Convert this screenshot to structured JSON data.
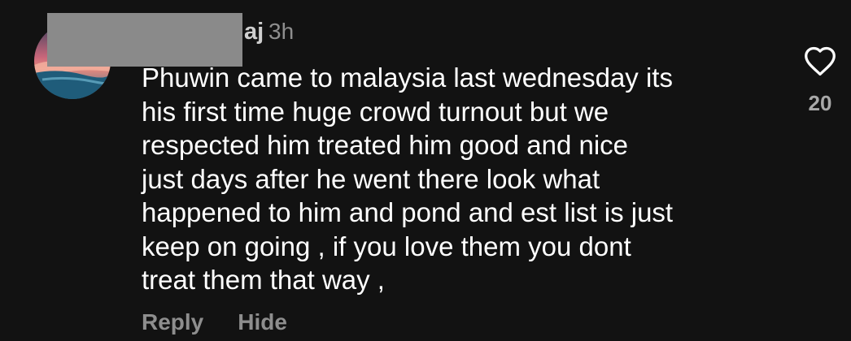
{
  "comment": {
    "username_suffix": "aj",
    "timestamp": "3h",
    "text": "Phuwin came to malaysia last wednesday its\nhis first time huge crowd turnout but we\nrespected him treated him good and nice\njust days after he went there look what\nhappened to him and pond and est list is just\nkeep on going , if you love them you dont\ntreat them that way ,",
    "actions": {
      "reply_label": "Reply",
      "hide_label": "Hide"
    },
    "likes": {
      "count": "20",
      "icon": "heart-outline-icon"
    }
  },
  "colors": {
    "background": "#121212",
    "text": "#ffffff",
    "muted": "#8e8e8e",
    "redaction": "#8a8a8a"
  }
}
